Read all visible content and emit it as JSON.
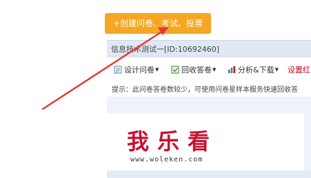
{
  "create_button": {
    "label": "+创建问卷、考试、投票"
  },
  "survey": {
    "title": "信息技术测试一[ID:10692460]"
  },
  "toolbar": {
    "items": [
      {
        "label": "设计问卷",
        "icon": "design-icon"
      },
      {
        "label": "回收答卷",
        "icon": "collect-icon"
      },
      {
        "label": "分析&下载",
        "icon": "chart-icon"
      },
      {
        "label": "设置红"
      }
    ]
  },
  "hint": {
    "text": "提示：此问卷答卷数较少，可使用问卷星样本服务快速回收答"
  },
  "watermark": {
    "brand": "我乐看",
    "url": "www.woleken.com"
  },
  "colors": {
    "accent": "#f5a623",
    "arrow": "#e53935",
    "header_bg": "#dfe8f3",
    "red_text": "#d0021b"
  }
}
